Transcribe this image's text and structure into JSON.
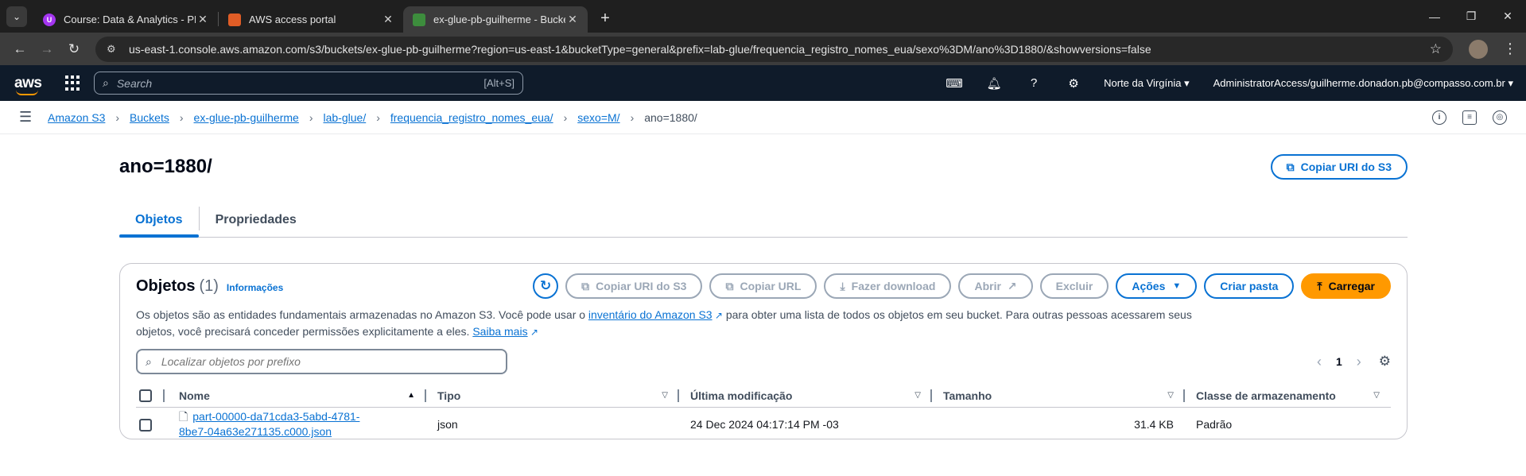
{
  "browser": {
    "tabs": [
      {
        "title": "Course: Data & Analytics - PB -",
        "favicon": "udemy-icon",
        "color": "#a435f0",
        "active": false
      },
      {
        "title": "AWS access portal",
        "favicon": "aws-cube-icon",
        "color": "#e05d26",
        "active": false
      },
      {
        "title": "ex-glue-pb-guilherme - Bucket",
        "favicon": "s3-bucket-icon",
        "color": "#3d8d3d",
        "active": true
      }
    ],
    "url": "us-east-1.console.aws.amazon.com/s3/buckets/ex-glue-pb-guilherme?region=us-east-1&bucketType=general&prefix=lab-glue/frequencia_registro_nomes_eua/sexo%3DM/ano%3D1880/&showversions=false"
  },
  "aws_nav": {
    "logo": "aws",
    "search_placeholder": "Search",
    "search_shortcut": "[Alt+S]",
    "region": "Norte da Virgínia",
    "account": "AdministratorAccess/guilherme.donadon.pb@compasso.com.br"
  },
  "breadcrumb": {
    "items": [
      "Amazon S3",
      "Buckets",
      "ex-glue-pb-guilherme",
      "lab-glue/",
      "frequencia_registro_nomes_eua/",
      "sexo=M/"
    ],
    "current": "ano=1880/"
  },
  "page": {
    "title": "ano=1880/",
    "copy_uri_label": "Copiar URI do S3",
    "tabs": [
      "Objetos",
      "Propriedades"
    ]
  },
  "objects": {
    "title": "Objetos",
    "count": "(1)",
    "info": "Informações",
    "buttons": {
      "copy_uri": "Copiar URI do S3",
      "copy_url": "Copiar URL",
      "download": "Fazer download",
      "open": "Abrir",
      "delete": "Excluir",
      "actions": "Ações",
      "create_folder": "Criar pasta",
      "upload": "Carregar"
    },
    "desc_part1": "Os objetos são as entidades fundamentais armazenadas no Amazon S3. Você pode usar o ",
    "desc_link1": "inventário do Amazon S3",
    "desc_part2": " para obter uma lista de todos os objetos em seu bucket. Para outras pessoas acessarem seus objetos, você precisará conceder permissões explicitamente a eles. ",
    "desc_link2": "Saiba mais",
    "filter_placeholder": "Localizar objetos por prefixo",
    "page": "1",
    "columns": [
      "Nome",
      "Tipo",
      "Última modificação",
      "Tamanho",
      "Classe de armazenamento"
    ],
    "rows": [
      {
        "name_line1": "part-00000-da71cda3-5abd-4781-",
        "name_line2": "8be7-04a63e271135.c000.json",
        "type": "json",
        "modified": "24 Dec 2024 04:17:14 PM -03",
        "size": "31.4 KB",
        "storage_class": "Padrão"
      }
    ]
  }
}
